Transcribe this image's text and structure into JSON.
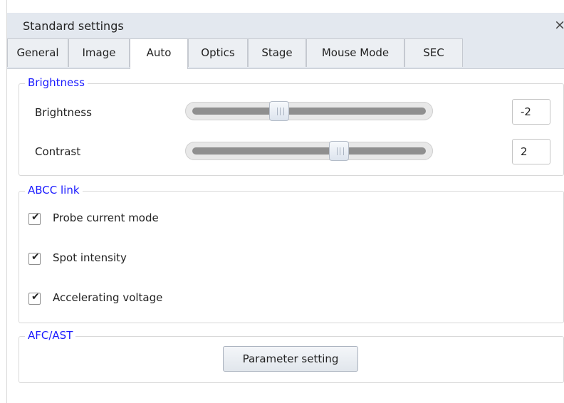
{
  "window": {
    "title": "Standard settings",
    "close_glyph": "×"
  },
  "tabs": [
    {
      "label": "General"
    },
    {
      "label": "Image"
    },
    {
      "label": "Auto"
    },
    {
      "label": "Optics"
    },
    {
      "label": "Stage"
    },
    {
      "label": "Mouse Mode"
    },
    {
      "label": "SEC"
    }
  ],
  "active_tab": "Auto",
  "brightness_group": {
    "legend": "Brightness",
    "brightness": {
      "label": "Brightness",
      "value": "-2",
      "slider_fraction": 0.36
    },
    "contrast": {
      "label": "Contrast",
      "value": "2",
      "slider_fraction": 0.64
    }
  },
  "abcc_group": {
    "legend": "ABCC link",
    "items": [
      {
        "label": "Probe current mode",
        "checked": true
      },
      {
        "label": "Spot intensity",
        "checked": true
      },
      {
        "label": "Accelerating voltage",
        "checked": true
      }
    ]
  },
  "afc_group": {
    "legend": "AFC/AST",
    "button_label": "Parameter setting"
  },
  "colors": {
    "legend": "#1a1aff",
    "titlebar": "#e3e8ef"
  },
  "icons": {
    "close": "close-icon",
    "check": "checkmark-icon"
  }
}
